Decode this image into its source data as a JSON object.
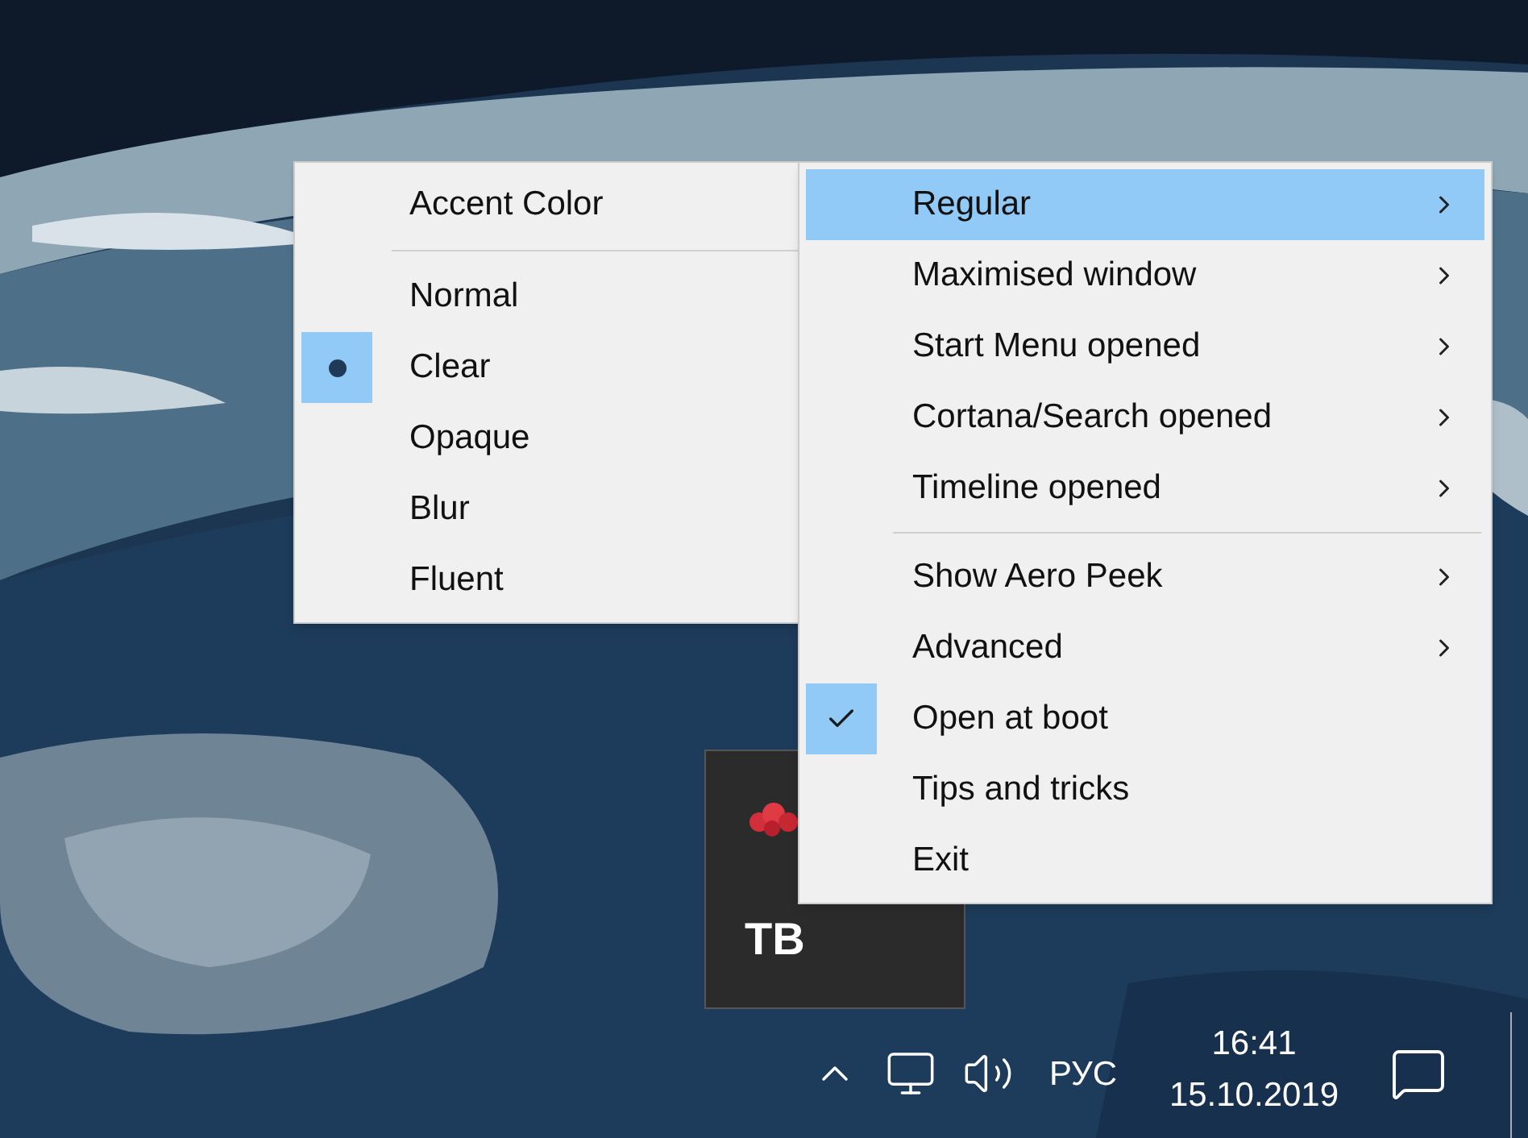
{
  "submenu": {
    "items": [
      {
        "kind": "command",
        "label": "Accent Color"
      },
      {
        "kind": "separator"
      },
      {
        "kind": "radio",
        "label": "Normal",
        "selected": false
      },
      {
        "kind": "radio",
        "label": "Clear",
        "selected": true
      },
      {
        "kind": "radio",
        "label": "Opaque",
        "selected": false
      },
      {
        "kind": "radio",
        "label": "Blur",
        "selected": false
      },
      {
        "kind": "radio",
        "label": "Fluent",
        "selected": false
      }
    ]
  },
  "menu": {
    "items": [
      {
        "kind": "item",
        "label": "Regular",
        "has_submenu": true,
        "checked": false,
        "highlighted": true
      },
      {
        "kind": "item",
        "label": "Maximised window",
        "has_submenu": true,
        "checked": false,
        "highlighted": false
      },
      {
        "kind": "item",
        "label": "Start Menu opened",
        "has_submenu": true,
        "checked": false,
        "highlighted": false
      },
      {
        "kind": "item",
        "label": "Cortana/Search opened",
        "has_submenu": true,
        "checked": false,
        "highlighted": false
      },
      {
        "kind": "item",
        "label": "Timeline opened",
        "has_submenu": true,
        "checked": false,
        "highlighted": false
      },
      {
        "kind": "separator"
      },
      {
        "kind": "item",
        "label": "Show Aero Peek",
        "has_submenu": true,
        "checked": false,
        "highlighted": false
      },
      {
        "kind": "item",
        "label": "Advanced",
        "has_submenu": true,
        "checked": false,
        "highlighted": false
      },
      {
        "kind": "item",
        "label": "Open at boot",
        "has_submenu": false,
        "checked": true,
        "highlighted": false
      },
      {
        "kind": "item",
        "label": "Tips and tricks",
        "has_submenu": false,
        "checked": false,
        "highlighted": false
      },
      {
        "kind": "item",
        "label": "Exit",
        "has_submenu": false,
        "checked": false,
        "highlighted": false
      }
    ]
  },
  "tray_overflow": {
    "app_logo_text": "TB"
  },
  "taskbar": {
    "language": "РУС",
    "time": "16:41",
    "date": "15.10.2019"
  }
}
